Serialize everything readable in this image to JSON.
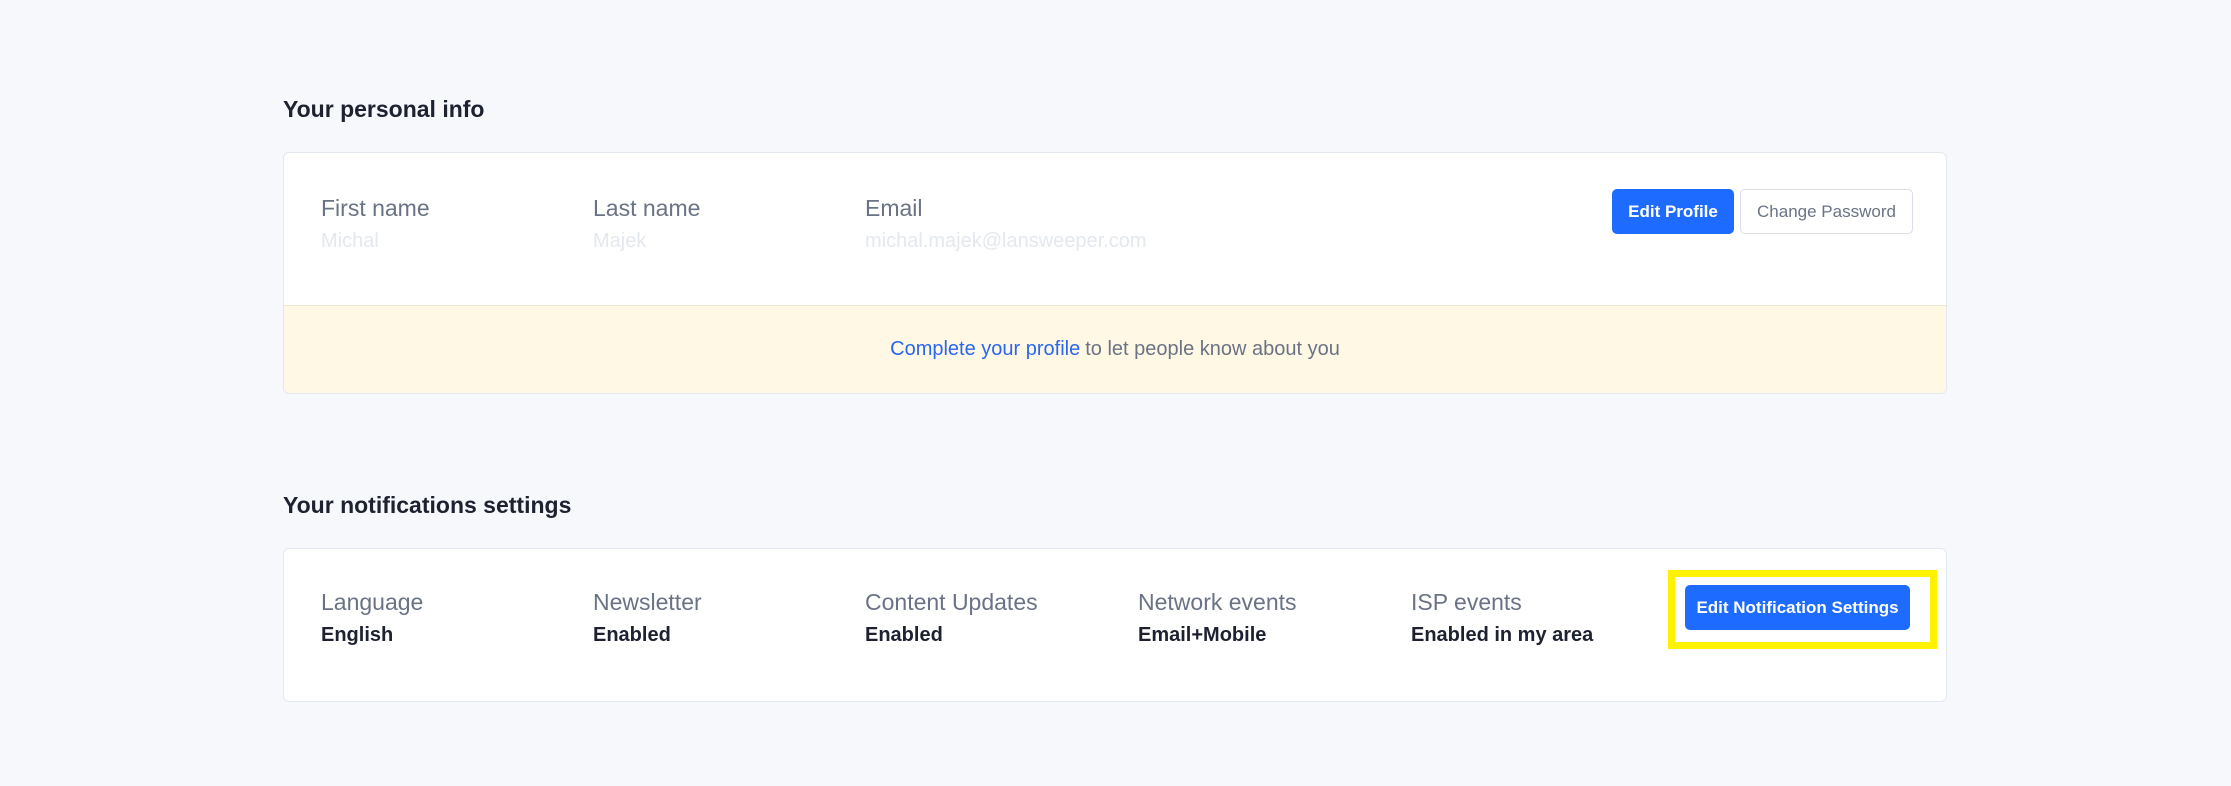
{
  "personal_info": {
    "title": "Your personal info",
    "fields": [
      {
        "label": "First name",
        "value": "Michal"
      },
      {
        "label": "Last name",
        "value": "Majek"
      },
      {
        "label": "Email",
        "value": "michal.majek@lansweeper.com"
      }
    ],
    "edit_profile_label": "Edit Profile",
    "change_password_label": "Change Password",
    "banner": {
      "link_text": "Complete your profile",
      "rest_text": "to let people know about you"
    }
  },
  "notifications": {
    "title": "Your notifications settings",
    "fields": [
      {
        "label": "Language",
        "value": "English"
      },
      {
        "label": "Newsletter",
        "value": "Enabled"
      },
      {
        "label": "Content Updates",
        "value": "Enabled"
      },
      {
        "label": "Network events",
        "value": "Email+Mobile"
      },
      {
        "label": "ISP events",
        "value": "Enabled in my area"
      }
    ],
    "edit_label": "Edit Notification Settings"
  },
  "colors": {
    "background": "#f6f8fc",
    "primary": "#1e6bff",
    "banner_bg": "#fff8e5",
    "link": "#2a66f0",
    "highlight": "#fff200"
  }
}
